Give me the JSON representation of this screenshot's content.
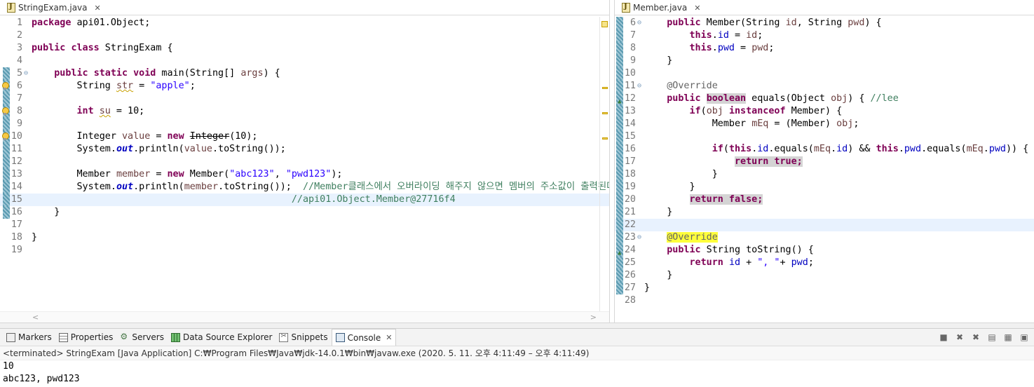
{
  "left_editor": {
    "tab_label": "StringExam.java",
    "close_glyph": "✕",
    "lines": [
      {
        "n": "1",
        "tokens": [
          {
            "t": "package",
            "c": "kw"
          },
          {
            "t": " api01.Object;"
          }
        ]
      },
      {
        "n": "2",
        "tokens": []
      },
      {
        "n": "3",
        "tokens": [
          {
            "t": "public",
            "c": "kw"
          },
          {
            "t": " "
          },
          {
            "t": "class",
            "c": "kw"
          },
          {
            "t": " StringExam {"
          }
        ]
      },
      {
        "n": "4",
        "tokens": []
      },
      {
        "n": "5",
        "fold": true,
        "cov": true,
        "tokens": [
          {
            "t": "    "
          },
          {
            "t": "public",
            "c": "kw"
          },
          {
            "t": " "
          },
          {
            "t": "static",
            "c": "kw"
          },
          {
            "t": " "
          },
          {
            "t": "void",
            "c": "kw"
          },
          {
            "t": " main(String[] "
          },
          {
            "t": "args",
            "c": "var"
          },
          {
            "t": ") {"
          }
        ]
      },
      {
        "n": "6",
        "bulb": true,
        "cov": true,
        "tokens": [
          {
            "t": "        String "
          },
          {
            "t": "str",
            "c": "var warn"
          },
          {
            "t": " = "
          },
          {
            "t": "\"apple\"",
            "c": "str"
          },
          {
            "t": ";"
          }
        ]
      },
      {
        "n": "7",
        "cov": true,
        "tokens": []
      },
      {
        "n": "8",
        "bulb": true,
        "cov": true,
        "tokens": [
          {
            "t": "        "
          },
          {
            "t": "int",
            "c": "kw"
          },
          {
            "t": " "
          },
          {
            "t": "su",
            "c": "var warn"
          },
          {
            "t": " = 10;"
          }
        ]
      },
      {
        "n": "9",
        "cov": true,
        "tokens": []
      },
      {
        "n": "10",
        "bulb": true,
        "cov": true,
        "tokens": [
          {
            "t": "        Integer "
          },
          {
            "t": "value",
            "c": "var"
          },
          {
            "t": " = "
          },
          {
            "t": "new",
            "c": "kw"
          },
          {
            "t": " "
          },
          {
            "t": "Integer",
            "c": "strike warn"
          },
          {
            "t": "(10);"
          }
        ]
      },
      {
        "n": "11",
        "cov": true,
        "tokens": [
          {
            "t": "        System."
          },
          {
            "t": "out",
            "c": "sfld"
          },
          {
            "t": ".println("
          },
          {
            "t": "value",
            "c": "var"
          },
          {
            "t": ".toString());"
          }
        ]
      },
      {
        "n": "12",
        "cov": true,
        "tokens": []
      },
      {
        "n": "13",
        "cov": true,
        "tokens": [
          {
            "t": "        Member "
          },
          {
            "t": "member",
            "c": "var"
          },
          {
            "t": " = "
          },
          {
            "t": "new",
            "c": "kw"
          },
          {
            "t": " Member("
          },
          {
            "t": "\"abc123\"",
            "c": "str"
          },
          {
            "t": ", "
          },
          {
            "t": "\"pwd123\"",
            "c": "str"
          },
          {
            "t": ");"
          }
        ]
      },
      {
        "n": "14",
        "cov": true,
        "tokens": [
          {
            "t": "        System."
          },
          {
            "t": "out",
            "c": "sfld"
          },
          {
            "t": ".println("
          },
          {
            "t": "member",
            "c": "var"
          },
          {
            "t": ".toString());  "
          },
          {
            "t": "//Member클래스에서 오버라이딩 해주지 않으면 멤버의 주소값이 출력된다.",
            "c": "cm"
          }
        ]
      },
      {
        "n": "15",
        "cov": true,
        "current": true,
        "tokens": [
          {
            "t": "                                              "
          },
          {
            "t": "//api01.Object.Member@27716f4",
            "c": "cm"
          }
        ]
      },
      {
        "n": "16",
        "cov": true,
        "tokens": [
          {
            "t": "    }"
          }
        ]
      },
      {
        "n": "17",
        "tokens": []
      },
      {
        "n": "18",
        "tokens": [
          {
            "t": "}"
          }
        ]
      },
      {
        "n": "19",
        "tokens": []
      }
    ]
  },
  "right_editor": {
    "tab_label": "Member.java",
    "close_glyph": "✕",
    "lines": [
      {
        "n": "6",
        "fold": true,
        "cov": true,
        "tokens": [
          {
            "t": "    "
          },
          {
            "t": "public",
            "c": "kw"
          },
          {
            "t": " Member(String "
          },
          {
            "t": "id",
            "c": "var"
          },
          {
            "t": ", String "
          },
          {
            "t": "pwd",
            "c": "var"
          },
          {
            "t": ") {"
          }
        ]
      },
      {
        "n": "7",
        "cov": true,
        "tokens": [
          {
            "t": "        "
          },
          {
            "t": "this",
            "c": "kw"
          },
          {
            "t": "."
          },
          {
            "t": "id",
            "c": "fld"
          },
          {
            "t": " = "
          },
          {
            "t": "id",
            "c": "var"
          },
          {
            "t": ";"
          }
        ]
      },
      {
        "n": "8",
        "cov": true,
        "tokens": [
          {
            "t": "        "
          },
          {
            "t": "this",
            "c": "kw"
          },
          {
            "t": "."
          },
          {
            "t": "pwd",
            "c": "fld"
          },
          {
            "t": " = "
          },
          {
            "t": "pwd",
            "c": "var"
          },
          {
            "t": ";"
          }
        ]
      },
      {
        "n": "9",
        "cov": true,
        "tokens": [
          {
            "t": "    }"
          }
        ]
      },
      {
        "n": "10",
        "cov": true,
        "tokens": []
      },
      {
        "n": "11",
        "fold": true,
        "cov": true,
        "tokens": [
          {
            "t": "    "
          },
          {
            "t": "@Override",
            "c": "ann"
          }
        ]
      },
      {
        "n": "12",
        "ovr": true,
        "cov": true,
        "tokens": [
          {
            "t": "    "
          },
          {
            "t": "public",
            "c": "kw"
          },
          {
            "t": " "
          },
          {
            "t": "boolean",
            "c": "kw hl-grey"
          },
          {
            "t": " equals(Object "
          },
          {
            "t": "obj",
            "c": "var"
          },
          {
            "t": ") { "
          },
          {
            "t": "//lee",
            "c": "cm"
          }
        ]
      },
      {
        "n": "13",
        "cov": true,
        "tokens": [
          {
            "t": "        "
          },
          {
            "t": "if",
            "c": "kw"
          },
          {
            "t": "("
          },
          {
            "t": "obj",
            "c": "var"
          },
          {
            "t": " "
          },
          {
            "t": "instanceof",
            "c": "kw"
          },
          {
            "t": " Member) {"
          }
        ]
      },
      {
        "n": "14",
        "cov": true,
        "tokens": [
          {
            "t": "            Member "
          },
          {
            "t": "mEq",
            "c": "var"
          },
          {
            "t": " = (Member) "
          },
          {
            "t": "obj",
            "c": "var"
          },
          {
            "t": ";"
          }
        ]
      },
      {
        "n": "15",
        "cov": true,
        "tokens": []
      },
      {
        "n": "16",
        "cov": true,
        "tokens": [
          {
            "t": "            "
          },
          {
            "t": "if",
            "c": "kw"
          },
          {
            "t": "("
          },
          {
            "t": "this",
            "c": "kw"
          },
          {
            "t": "."
          },
          {
            "t": "id",
            "c": "fld"
          },
          {
            "t": ".equals("
          },
          {
            "t": "mEq",
            "c": "var"
          },
          {
            "t": "."
          },
          {
            "t": "id",
            "c": "fld"
          },
          {
            "t": ") && "
          },
          {
            "t": "this",
            "c": "kw"
          },
          {
            "t": "."
          },
          {
            "t": "pwd",
            "c": "fld"
          },
          {
            "t": ".equals("
          },
          {
            "t": "mEq",
            "c": "var"
          },
          {
            "t": "."
          },
          {
            "t": "pwd",
            "c": "fld"
          },
          {
            "t": ")) {"
          }
        ]
      },
      {
        "n": "17",
        "cov": true,
        "tokens": [
          {
            "t": "                "
          },
          {
            "t": "return true;",
            "c": "kw hl-grey"
          }
        ]
      },
      {
        "n": "18",
        "cov": true,
        "tokens": [
          {
            "t": "            }"
          }
        ]
      },
      {
        "n": "19",
        "cov": true,
        "tokens": [
          {
            "t": "        }"
          }
        ]
      },
      {
        "n": "20",
        "cov": true,
        "tokens": [
          {
            "t": "        "
          },
          {
            "t": "return false;",
            "c": "kw hl-grey"
          }
        ]
      },
      {
        "n": "21",
        "cov": true,
        "tokens": [
          {
            "t": "    }"
          }
        ]
      },
      {
        "n": "22",
        "cov": true,
        "current": true,
        "tokens": []
      },
      {
        "n": "23",
        "fold": true,
        "cov": true,
        "tokens": [
          {
            "t": "    "
          },
          {
            "t": "@Override",
            "c": "ann hl-yellow"
          }
        ]
      },
      {
        "n": "24",
        "ovr": true,
        "cov": true,
        "tokens": [
          {
            "t": "    "
          },
          {
            "t": "public",
            "c": "kw"
          },
          {
            "t": " String toString() {"
          }
        ]
      },
      {
        "n": "25",
        "cov": true,
        "tokens": [
          {
            "t": "        "
          },
          {
            "t": "return",
            "c": "kw"
          },
          {
            "t": " "
          },
          {
            "t": "id",
            "c": "fld"
          },
          {
            "t": " + "
          },
          {
            "t": "\", \"",
            "c": "str"
          },
          {
            "t": "+ "
          },
          {
            "t": "pwd",
            "c": "fld"
          },
          {
            "t": ";"
          }
        ]
      },
      {
        "n": "26",
        "cov": true,
        "tokens": [
          {
            "t": "    }"
          }
        ]
      },
      {
        "n": "27",
        "cov": true,
        "tokens": [
          {
            "t": "}"
          }
        ]
      },
      {
        "n": "28",
        "tokens": []
      }
    ]
  },
  "console": {
    "tabs": [
      {
        "label": "Markers",
        "icon": "markers-icon"
      },
      {
        "label": "Properties",
        "icon": "properties-icon"
      },
      {
        "label": "Servers",
        "icon": "servers-icon"
      },
      {
        "label": "Data Source Explorer",
        "icon": "data-source-icon"
      },
      {
        "label": "Snippets",
        "icon": "snippets-icon"
      },
      {
        "label": "Console",
        "icon": "console-icon",
        "active": true
      }
    ],
    "close_glyph": "✕",
    "status": "<terminated> StringExam [Java Application] C:₩Program Files₩Java₩jdk-14.0.1₩bin₩javaw.exe  (2020. 5. 11. 오후 4:11:49 – 오후 4:11:49)",
    "output": [
      "10",
      "abc123, pwd123"
    ],
    "toolbar": [
      {
        "name": "terminate-icon",
        "glyph": "■"
      },
      {
        "name": "remove-launch-icon",
        "glyph": "✖"
      },
      {
        "name": "remove-all-icon",
        "glyph": "✖"
      },
      {
        "name": "clear-console-icon",
        "glyph": "▤"
      },
      {
        "name": "scroll-lock-icon",
        "glyph": "▦"
      },
      {
        "name": "pin-console-icon",
        "glyph": "▣"
      }
    ]
  },
  "colors": {
    "keyword": "#7f0055",
    "string": "#2a00ff",
    "comment": "#3f7f5f",
    "field": "#0000c0",
    "current_line": "#e8f2fe",
    "occurrence_highlight": "#ffff3c"
  }
}
